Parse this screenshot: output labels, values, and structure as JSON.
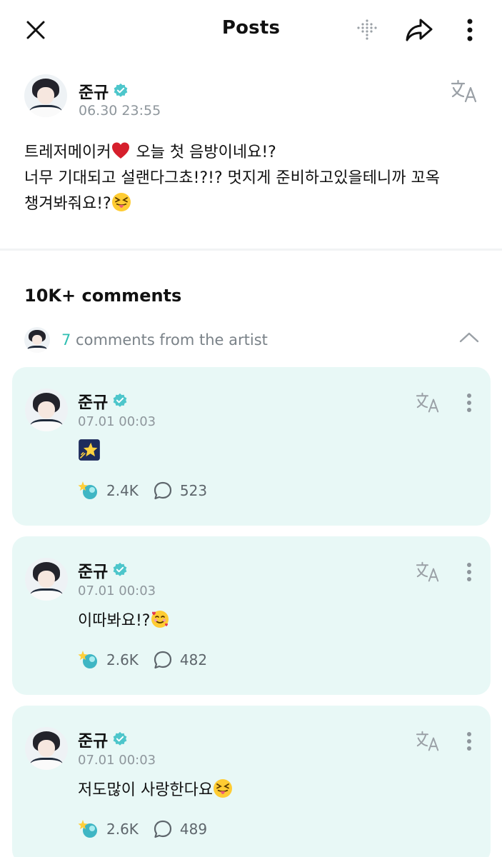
{
  "topbar": {
    "title": "Posts",
    "icons": [
      "close-icon",
      "grid-icon",
      "share-icon",
      "more-vertical-icon"
    ]
  },
  "post": {
    "author": "준규",
    "timestamp": "06.30 23:55",
    "line1_a": "트레저메이커",
    "line1_b": " 오늘 첫 음방이네요!?",
    "line2": "너무 기대되고 설랜다그쵸!?!? 멋지게 준비하고있을테니까 꼬옥",
    "line3": "챙겨봐줘요!?",
    "emojis": [
      "red-heart",
      "squinting-face-with-tongue"
    ]
  },
  "comments": {
    "title": "10K+ comments",
    "artist_count": "7",
    "artist_label": " comments from the artist"
  },
  "cards": [
    {
      "author": "준규",
      "timestamp": "07.01 00:03",
      "text": "",
      "emoji": "glowing-star",
      "likes": "2.4K",
      "replies": "523"
    },
    {
      "author": "준규",
      "timestamp": "07.01 00:03",
      "text": "이따봐요!?",
      "emoji": "smiling-face-with-hearts",
      "likes": "2.6K",
      "replies": "482"
    },
    {
      "author": "준규",
      "timestamp": "07.01 00:03",
      "text": "저도많이 사랑한다요",
      "emoji": "squinting-face-with-tongue",
      "likes": "2.6K",
      "replies": "489"
    }
  ],
  "colors": {
    "accent": "#2fbfb2",
    "card_background": "#e8f8f6",
    "muted_text": "#8e969c",
    "verified_badge": "#4dc6cb"
  }
}
